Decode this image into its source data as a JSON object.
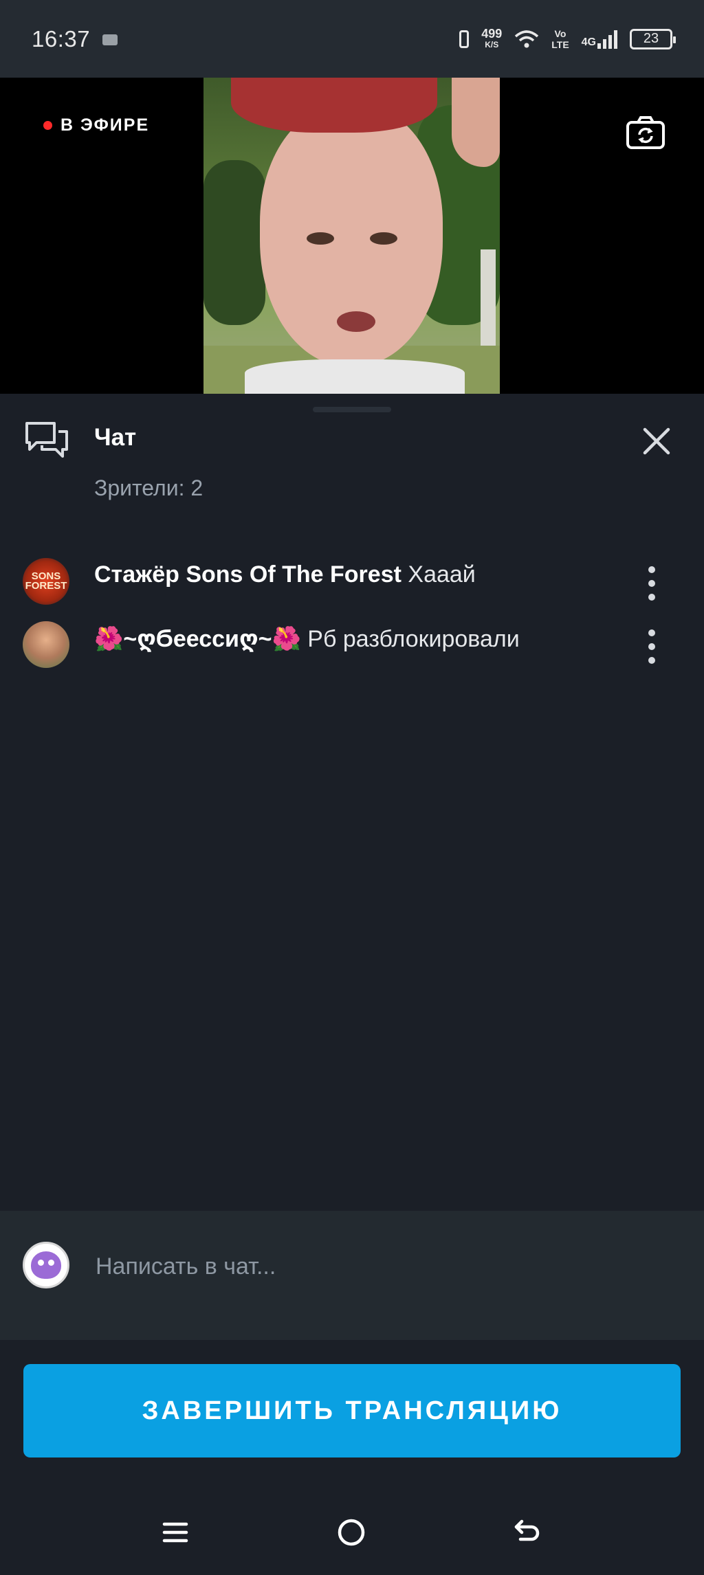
{
  "status_bar": {
    "time": "16:37",
    "speed_top": "499",
    "speed_bottom": "K/S",
    "volte_top": "Vo",
    "volte_bottom": "LTE",
    "network": "4G",
    "battery": "23"
  },
  "video": {
    "live_label": "В ЭФИРЕ",
    "live_color": "#ff2a2a"
  },
  "chat": {
    "title": "Чат",
    "viewers": "Зрители: 2",
    "messages": [
      {
        "author": "Стажёр Sons Of The Forest",
        "text": "Хааай",
        "avatar_text": "SONS FOREST"
      },
      {
        "author": "🌺~ღϬеессиღ~🌺",
        "text": "Рб разблокировали"
      }
    ]
  },
  "input": {
    "placeholder": "Написать в чат..."
  },
  "end_button": {
    "label": "ЗАВЕРШИТЬ ТРАНСЛЯЦИЮ",
    "color": "#0aa0e2"
  },
  "icons": {
    "camera_switch": "camera-switch-icon",
    "chat": "chat-bubbles-icon",
    "close": "close-icon",
    "more": "more-vertical-icon",
    "nav_menu": "menu-icon",
    "nav_home": "home-icon",
    "nav_back": "back-icon"
  }
}
